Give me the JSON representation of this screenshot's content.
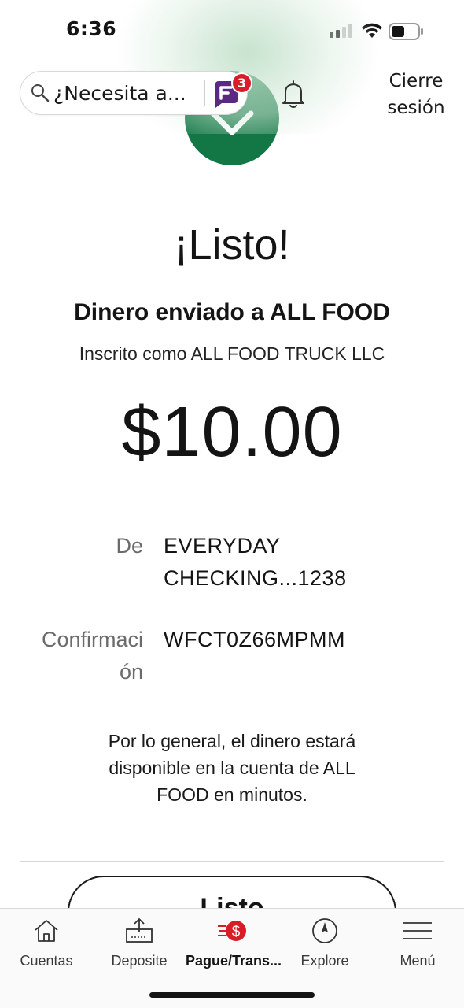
{
  "status_bar": {
    "time": "6:36"
  },
  "header": {
    "search_placeholder": "¿Necesita a...",
    "assistant_badge_count": "3",
    "signout_label": "Cierre sesión"
  },
  "confirmation": {
    "title": "¡Listo!",
    "recipient_line": "Dinero enviado a ALL FOOD",
    "enrolled_as": "Inscrito como ALL FOOD TRUCK LLC",
    "amount": "$10.00",
    "from_label": "De",
    "from_value_line1": "EVERYDAY",
    "from_value_line2": "CHECKING...1238",
    "confirmation_label_line1": "Confirmaci",
    "confirmation_label_line2": "ón",
    "confirmation_value": "WFCT0Z66MPMM",
    "note_line1": "Por lo general, el dinero estará",
    "note_line2": "disponible en la cuenta de ALL",
    "note_line3": "FOOD en minutos.",
    "done_button": "Listo"
  },
  "tab_bar": {
    "items": [
      {
        "label": "Cuentas",
        "icon": "home-icon",
        "active": false
      },
      {
        "label": "Deposite",
        "icon": "deposit-icon",
        "active": false
      },
      {
        "label": "Pague/Trans...",
        "icon": "pay-transfer-icon",
        "active": true
      },
      {
        "label": "Explore",
        "icon": "compass-icon",
        "active": false
      },
      {
        "label": "Menú",
        "icon": "hamburger-menu-icon",
        "active": false
      }
    ]
  },
  "colors": {
    "success_green": "#127745",
    "brand_red": "#d71e28",
    "assistant_purple": "#5a2a82"
  }
}
